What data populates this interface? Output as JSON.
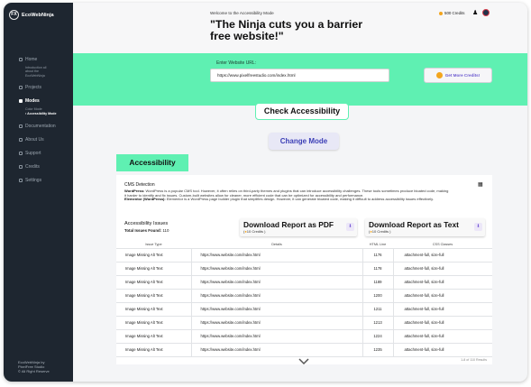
{
  "app": {
    "name": "EcoWebNinja",
    "badge": "FX"
  },
  "sidebar": {
    "items": [
      {
        "label": "Home"
      },
      {
        "label": "Projects"
      },
      {
        "label": "Modes"
      },
      {
        "label": "Documentation"
      },
      {
        "label": "About Us"
      },
      {
        "label": "Support"
      },
      {
        "label": "Credits"
      },
      {
        "label": "Settings"
      }
    ],
    "home_sub": [
      "Introduction all",
      "about the",
      "EcoWebNinja"
    ],
    "modes_sub": [
      "Color Mode",
      "Accessibility Mode"
    ],
    "footer": [
      "EcoWebNinja by",
      "PixelFree Studio",
      "© All Right Reserve"
    ]
  },
  "header": {
    "welcome": "Welcome to the Accessibility Mode",
    "headline": "\"The Ninja cuts you a barrier free website!\"",
    "credits": "500 Credits"
  },
  "url_section": {
    "label": "Enter Website URL:",
    "value": "https://www.pixelfreestudio.com/index.html",
    "more_credits": "Get More Credits!"
  },
  "actions": {
    "check": "Check Accessibility",
    "change_mode": "Change Mode",
    "tab": "Accessibility"
  },
  "cms": {
    "title": "CMS Detection",
    "wp_label": "WordPress:",
    "wp_text": "WordPress is a popular CMS tool. However, it often relies on third-party themes and plugins that can introduce accessibility challenges. These tools sometimes produce bloated code, making it harder to identify and fix issues. Custom-built websites allow for cleaner, more efficient code that can be optimized for accessibility and performance.",
    "el_label": "Elementor (WordPress):",
    "el_text": "Elementor is a WordPress page builder plugin that simplifies design. However, it can generate bloated code, making it difficult to address accessibility issues effectively."
  },
  "issues": {
    "title": "Accessibility Issues",
    "found_label": "Total Issues Found:",
    "found_value": "110",
    "download_pdf": {
      "label": "Download Report as PDF",
      "cost": "10",
      "unit": "Credits )"
    },
    "download_text": {
      "label": "Download Report as Text",
      "cost": "10",
      "unit": "Credits )"
    },
    "columns": [
      "Issue Type",
      "Details",
      "HTML Line",
      "CSS Classes"
    ],
    "rows": [
      [
        "Image Missing Alt Text",
        "https://www.website.com/index.html",
        "1176",
        "attachment-full, size-full"
      ],
      [
        "Image Missing Alt Text",
        "https://www.website.com/index.html",
        "1178",
        "attachment-full, size-full"
      ],
      [
        "Image Missing Alt Text",
        "https://www.website.com/index.html",
        "1189",
        "attachment-full, size-full"
      ],
      [
        "Image Missing Alt Text",
        "https://www.website.com/index.html",
        "1200",
        "attachment-full, size-full"
      ],
      [
        "Image Missing Alt Text",
        "https://www.website.com/index.html",
        "1211",
        "attachment-full, size-full"
      ],
      [
        "Image Missing Alt Text",
        "https://www.website.com/index.html",
        "1213",
        "attachment-full, size-full"
      ],
      [
        "Image Missing Alt Text",
        "https://www.website.com/index.html",
        "1224",
        "attachment-full, size-full"
      ],
      [
        "Image Missing Alt Text",
        "https://www.website.com/index.html",
        "1235",
        "attachment-full, size-full"
      ]
    ],
    "result_count": "1-8 of 110 Results"
  },
  "colors": {
    "accent_green": "#5ff0b2",
    "sidebar_bg": "#1e2630",
    "mode_text": "#3c3fb6",
    "coin": "#f3a51d"
  }
}
